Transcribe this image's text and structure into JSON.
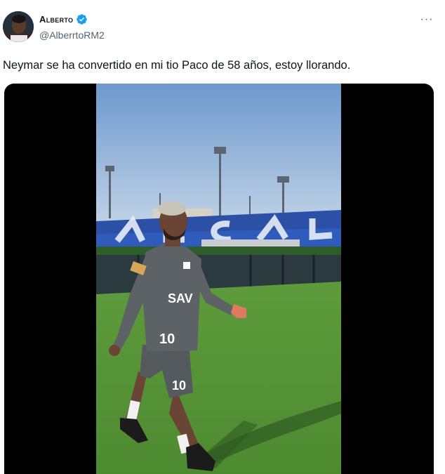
{
  "author": {
    "display_name": "Alberto",
    "handle": "@AlberrtoRM2",
    "verified": true,
    "avatar_icon": "avatar-photo"
  },
  "tweet": {
    "text": "Neymar se ha convertido en mi tio Paco de 58 años, estoy llorando."
  },
  "media": {
    "type": "video",
    "stadium_sign_letters": "ALCAL",
    "jersey_number": "10",
    "shorts_number": "10",
    "sponsor": "SAV"
  },
  "icons": {
    "more": "more-options-icon",
    "verified": "verified-badge-icon"
  },
  "colors": {
    "verified_blue": "#1d9bf0",
    "handle_gray": "#536471",
    "text_black": "#0f1419",
    "sky": "#7fa6d3",
    "pitch": "#5f9a3e",
    "stands": "#2a4fa5"
  }
}
